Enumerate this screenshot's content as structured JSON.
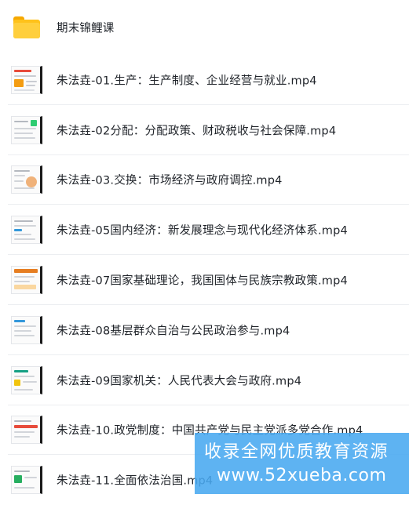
{
  "files": [
    {
      "name": "期末锦鲤课",
      "type": "folder",
      "icon": "folder-icon"
    },
    {
      "name": "朱法垚-01.生产：生产制度、企业经营与就业.mp4",
      "type": "video",
      "icon": "video-thumbnail-icon"
    },
    {
      "name": "朱法垚-02分配：分配政策、财政税收与社会保障.mp4",
      "type": "video",
      "icon": "video-thumbnail-icon"
    },
    {
      "name": "朱法垚-03.交换：市场经济与政府调控.mp4",
      "type": "video",
      "icon": "video-thumbnail-icon"
    },
    {
      "name": "朱法垚-05国内经济：新发展理念与现代化经济体系.mp4",
      "type": "video",
      "icon": "video-thumbnail-icon"
    },
    {
      "name": "朱法垚-07国家基础理论，我国国体与民族宗教政策.mp4",
      "type": "video",
      "icon": "video-thumbnail-icon"
    },
    {
      "name": "朱法垚-08基层群众自治与公民政治参与.mp4",
      "type": "video",
      "icon": "video-thumbnail-icon"
    },
    {
      "name": "朱法垚-09国家机关：人民代表大会与政府.mp4",
      "type": "video",
      "icon": "video-thumbnail-icon"
    },
    {
      "name": "朱法垚-10.政党制度：中国共产党与民主党派多党合作.mp4",
      "type": "video",
      "icon": "video-thumbnail-icon"
    },
    {
      "name": "朱法垚-11.全面依法治国.mp4",
      "type": "video",
      "icon": "video-thumbnail-icon"
    }
  ],
  "watermark": {
    "line1": "收录全网优质教育资源",
    "line2": "www.52xueba.com"
  },
  "colors": {
    "folder": "#ffc21a",
    "separator": "#eceef1",
    "watermark_bg": "#48a8f0"
  }
}
